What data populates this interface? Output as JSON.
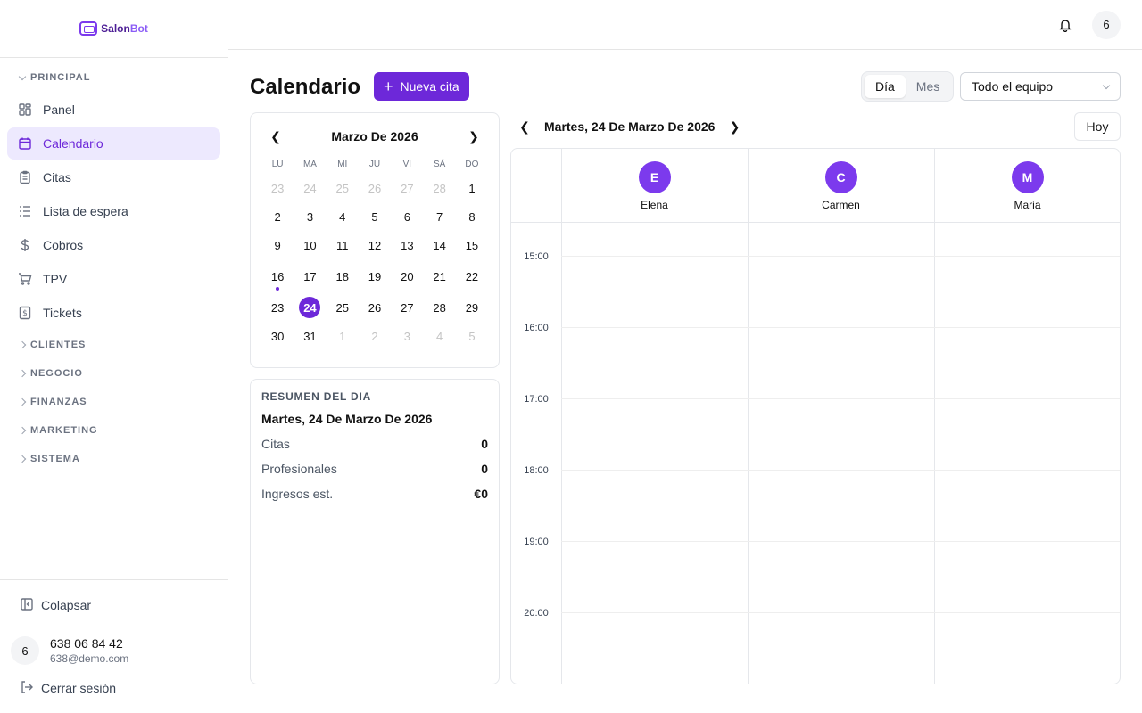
{
  "brand": {
    "name_a": "Salon",
    "name_b": "Bot"
  },
  "sidebar": {
    "principal_label": "PRINCIPAL",
    "items": [
      {
        "label": "Panel",
        "icon": "grid-icon"
      },
      {
        "label": "Calendario",
        "icon": "calendar-icon",
        "active": true
      },
      {
        "label": "Citas",
        "icon": "clipboard-icon"
      },
      {
        "label": "Lista de espera",
        "icon": "list-icon"
      },
      {
        "label": "Cobros",
        "icon": "dollar-icon"
      },
      {
        "label": "TPV",
        "icon": "cart-icon"
      },
      {
        "label": "Tickets",
        "icon": "receipt-icon"
      }
    ],
    "groups": [
      "CLIENTES",
      "NEGOCIO",
      "FINANZAS",
      "MARKETING",
      "SISTEMA"
    ],
    "collapse_label": "Colapsar",
    "user": {
      "initial": "6",
      "name": "638 06 84 42",
      "email": "638@demo.com"
    },
    "logout_label": "Cerrar sesión"
  },
  "topbar": {
    "avatar_initial": "6"
  },
  "page": {
    "title": "Calendario",
    "new_button": "Nueva cita",
    "view_day": "Día",
    "view_month": "Mes",
    "team_select": "Todo el equipo"
  },
  "mini_calendar": {
    "title": "Marzo De 2026",
    "weekdays": [
      "LU",
      "MA",
      "MI",
      "JU",
      "VI",
      "SÁ",
      "DO"
    ],
    "weeks": [
      [
        "23",
        "24",
        "25",
        "26",
        "27",
        "28",
        "1"
      ],
      [
        "2",
        "3",
        "4",
        "5",
        "6",
        "7",
        "8"
      ],
      [
        "9",
        "10",
        "11",
        "12",
        "13",
        "14",
        "15"
      ],
      [
        "16",
        "17",
        "18",
        "19",
        "20",
        "21",
        "22"
      ],
      [
        "23",
        "24",
        "25",
        "26",
        "27",
        "28",
        "29"
      ],
      [
        "30",
        "31",
        "1",
        "2",
        "3",
        "4",
        "5"
      ]
    ],
    "selected": "24"
  },
  "summary": {
    "label": "RESUMEN DEL DIA",
    "date": "Martes, 24 De Marzo De 2026",
    "rows": [
      {
        "k": "Citas",
        "v": "0"
      },
      {
        "k": "Profesionales",
        "v": "0"
      },
      {
        "k": "Ingresos est.",
        "v": "€0"
      }
    ]
  },
  "day_view": {
    "title": "Martes, 24 De Marzo De 2026",
    "today_button": "Hoy",
    "staff": [
      {
        "initial": "E",
        "name": "Elena"
      },
      {
        "initial": "C",
        "name": "Carmen"
      },
      {
        "initial": "M",
        "name": "Maria"
      }
    ],
    "hours": [
      "15:00",
      "16:00",
      "17:00",
      "18:00",
      "19:00",
      "20:00"
    ]
  },
  "colors": {
    "accent": "#6d28d9",
    "accent_light": "#ede9fe",
    "avatar": "#7c3aed"
  }
}
